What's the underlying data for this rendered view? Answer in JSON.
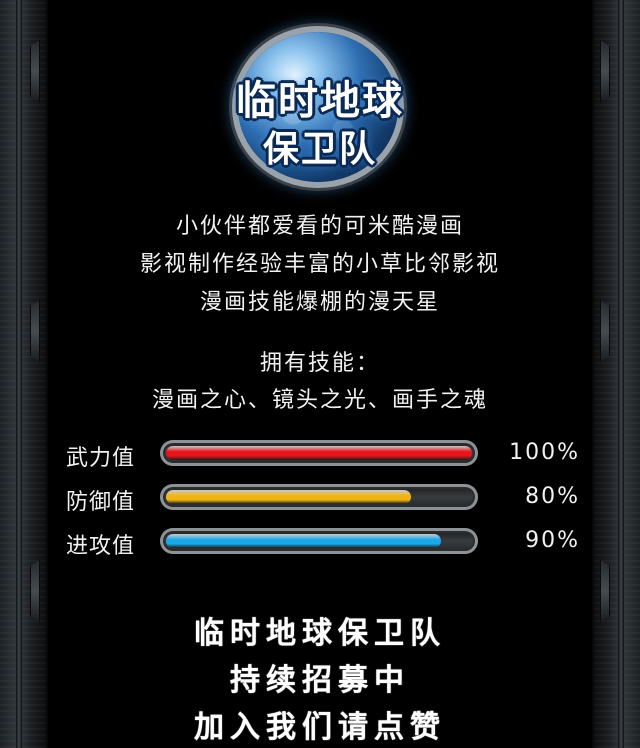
{
  "logo": {
    "line1": "临时地球",
    "line2": "保卫队"
  },
  "description": [
    "小伙伴都爱看的可米酷漫画",
    "影视制作经验丰富的小草比邻影视",
    "漫画技能爆棚的漫天星"
  ],
  "skills": {
    "heading": "拥有技能：",
    "list": "漫画之心、镜头之光、画手之魂"
  },
  "stats": [
    {
      "label": "武力值",
      "value_text": "100%",
      "value": 1.0,
      "color": "#e8141a"
    },
    {
      "label": "防御值",
      "value_text": "80%",
      "value": 0.8,
      "color": "#f0b414"
    },
    {
      "label": "进攻值",
      "value_text": "90%",
      "value": 0.9,
      "color": "#1aa8e8"
    }
  ],
  "slogan": [
    "临时地球保卫队",
    "持续招募中",
    "加入我们请点赞"
  ]
}
